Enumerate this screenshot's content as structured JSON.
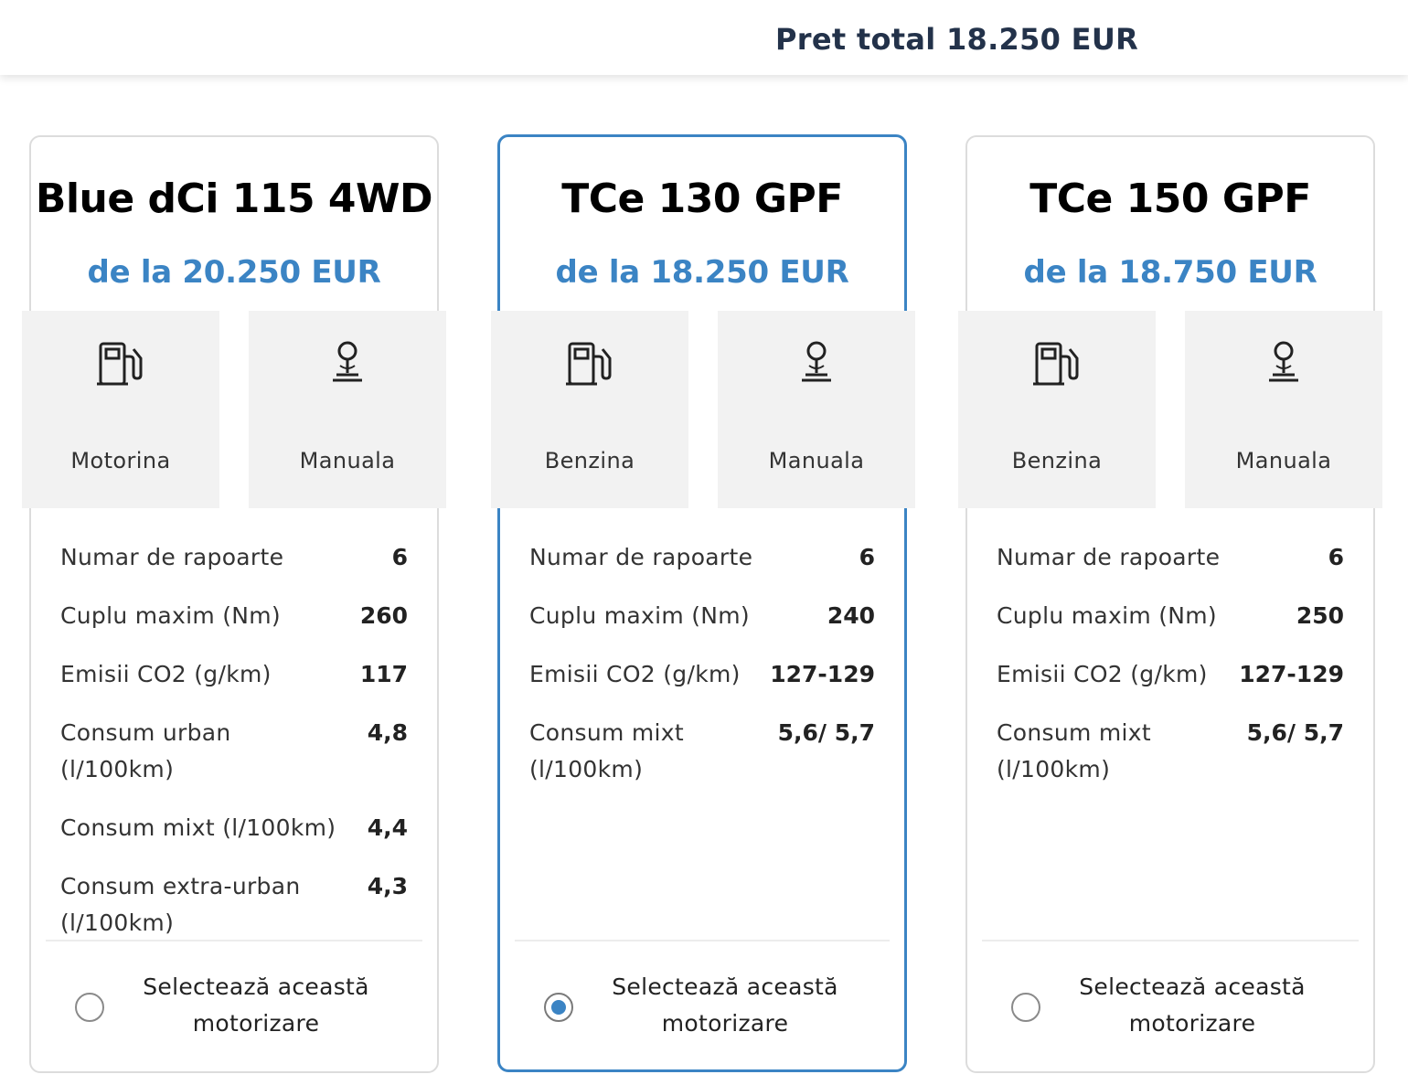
{
  "header": {
    "total_price": "Pret total 18.250 EUR"
  },
  "colors": {
    "accent": "#3b84c4",
    "border": "#dcdcdc",
    "tile_bg": "#f2f2f2"
  },
  "cards": [
    {
      "title": "Blue dCi 115 4WD",
      "price": "de la 20.250 EUR",
      "fuel": {
        "icon": "fuel-pump-icon",
        "label": "Motorina"
      },
      "transmission": {
        "icon": "gear-stick-icon",
        "label": "Manuala"
      },
      "specs": [
        {
          "label": "Numar de rapoarte",
          "value": "6"
        },
        {
          "label": "Cuplu maxim (Nm)",
          "value": "260"
        },
        {
          "label": "Emisii CO2 (g/km)",
          "value": "117"
        },
        {
          "label": "Consum urban (l/100km)",
          "value": "4,8"
        },
        {
          "label": "Consum mixt (l/100km)",
          "value": "4,4"
        },
        {
          "label": "Consum extra-urban (l/100km)",
          "value": "4,3"
        }
      ],
      "select_label": "Selectează această motorizare",
      "selected": false
    },
    {
      "title": "TCe 130 GPF",
      "price": "de la 18.250 EUR",
      "fuel": {
        "icon": "fuel-pump-icon",
        "label": "Benzina"
      },
      "transmission": {
        "icon": "gear-stick-icon",
        "label": "Manuala"
      },
      "specs": [
        {
          "label": "Numar de rapoarte",
          "value": "6"
        },
        {
          "label": "Cuplu maxim (Nm)",
          "value": "240"
        },
        {
          "label": "Emisii CO2 (g/km)",
          "value": "127-129"
        },
        {
          "label": "Consum mixt (l/100km)",
          "value": "5,6/ 5,7"
        }
      ],
      "select_label": "Selectează această motorizare",
      "selected": true
    },
    {
      "title": "TCe 150 GPF",
      "price": "de la 18.750 EUR",
      "fuel": {
        "icon": "fuel-pump-icon",
        "label": "Benzina"
      },
      "transmission": {
        "icon": "gear-stick-icon",
        "label": "Manuala"
      },
      "specs": [
        {
          "label": "Numar de rapoarte",
          "value": "6"
        },
        {
          "label": "Cuplu maxim (Nm)",
          "value": "250"
        },
        {
          "label": "Emisii CO2 (g/km)",
          "value": "127-129"
        },
        {
          "label": "Consum mixt (l/100km)",
          "value": "5,6/ 5,7"
        }
      ],
      "select_label": "Selectează această motorizare",
      "selected": false
    }
  ]
}
